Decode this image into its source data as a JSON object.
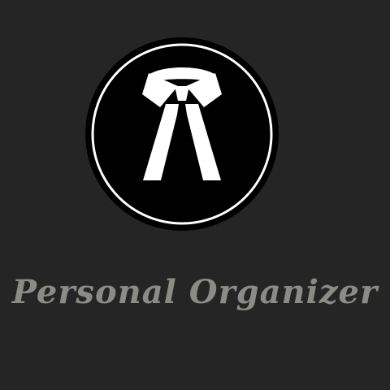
{
  "splash": {
    "app_title": "Personal Organizer",
    "logo_icon": "lawyer-bands-icon"
  },
  "colors": {
    "background": "#252525",
    "logo_disc": "#000000",
    "logo_ring": "#ffffff",
    "logo_glyph": "#ffffff",
    "title_text": "#8c8c87"
  }
}
